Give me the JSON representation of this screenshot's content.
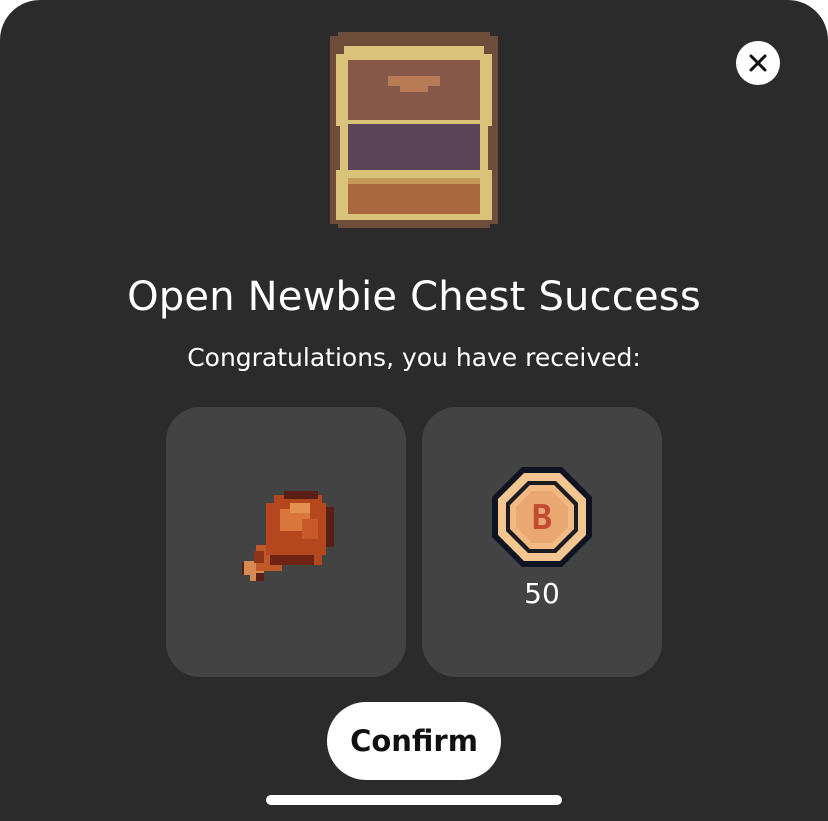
{
  "dialog": {
    "title": "Open Newbie Chest Success",
    "subtitle": "Congratulations, you have received:",
    "confirm_label": "Confirm"
  },
  "rewards": [
    {
      "icon": "drumstick-icon",
      "quantity": ""
    },
    {
      "icon": "b-coin-icon",
      "quantity": "50"
    }
  ],
  "colors": {
    "modal_bg": "#2b2b2b",
    "card_bg": "#434343",
    "button_bg": "#ffffff"
  }
}
